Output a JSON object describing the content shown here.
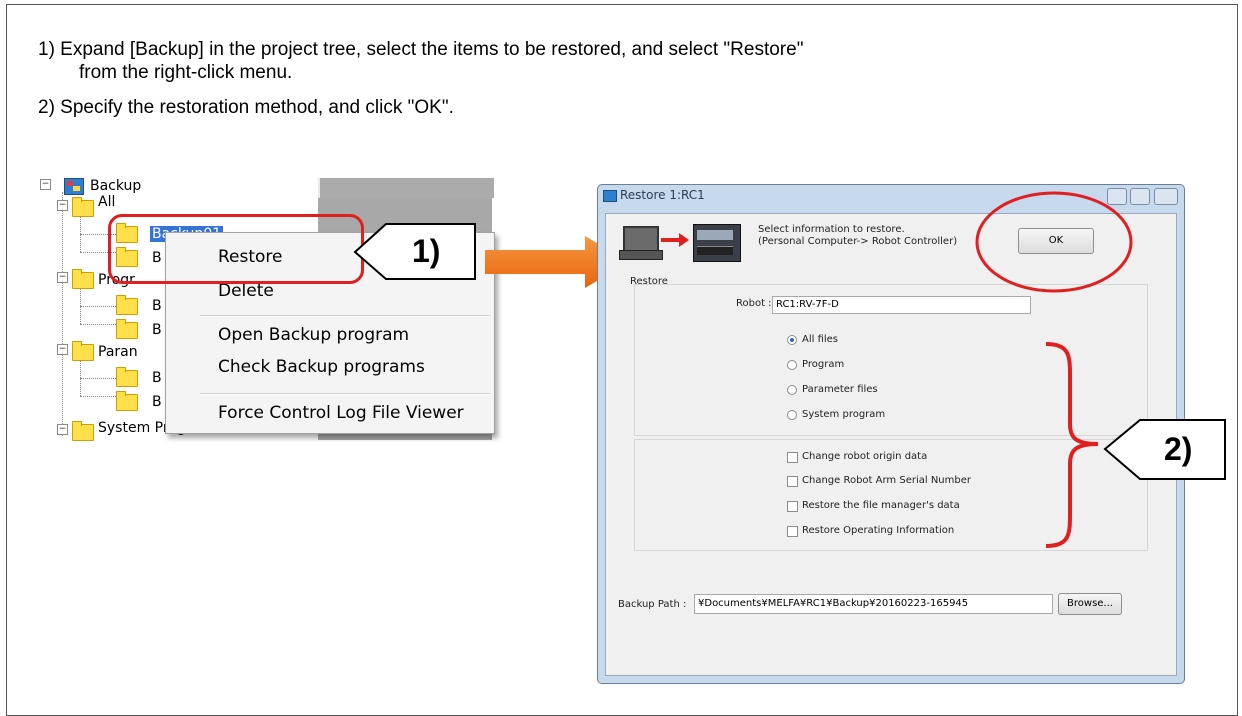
{
  "instructions": {
    "step1_line1": "1)  Expand [Backup] in the project tree, select the items to be restored, and select \"Restore\"",
    "step1_line2": "from the right-click menu.",
    "step2": "2)  Specify the restoration method, and click \"OK\"."
  },
  "tree": {
    "root": "Backup",
    "all": "All",
    "selected": "Backup01",
    "b": "B",
    "program": "Progr",
    "param": "Paran",
    "system": "System Program"
  },
  "context_menu": {
    "items": [
      "Restore",
      "Delete",
      "Open Backup program",
      "Check Backup programs",
      "Force Control Log File Viewer"
    ]
  },
  "callouts": {
    "one": "1)",
    "two": "2)"
  },
  "dialog": {
    "title": "Restore 1:RC1",
    "info_line1": "Select information to restore.",
    "info_line2": "(Personal Computer-> Robot Controller)",
    "ok_label": "OK",
    "icon_caption": "Restore",
    "robot_label": "Robot :",
    "robot_value": "RC1:RV-7F-D",
    "options": [
      "All files",
      "Program",
      "Parameter files",
      "System program"
    ],
    "checkboxes": [
      "Change robot origin data",
      "Change Robot Arm Serial Number",
      "Restore the file manager's data",
      "Restore Operating Information"
    ],
    "backup_path_label": "Backup Path :",
    "backup_path_value": "¥Documents¥MELFA¥RC1¥Backup¥20160223-165945",
    "browse_label": "Browse..."
  },
  "colors": {
    "accent_red": "#e02020",
    "arrow_orange": "#f07820"
  }
}
